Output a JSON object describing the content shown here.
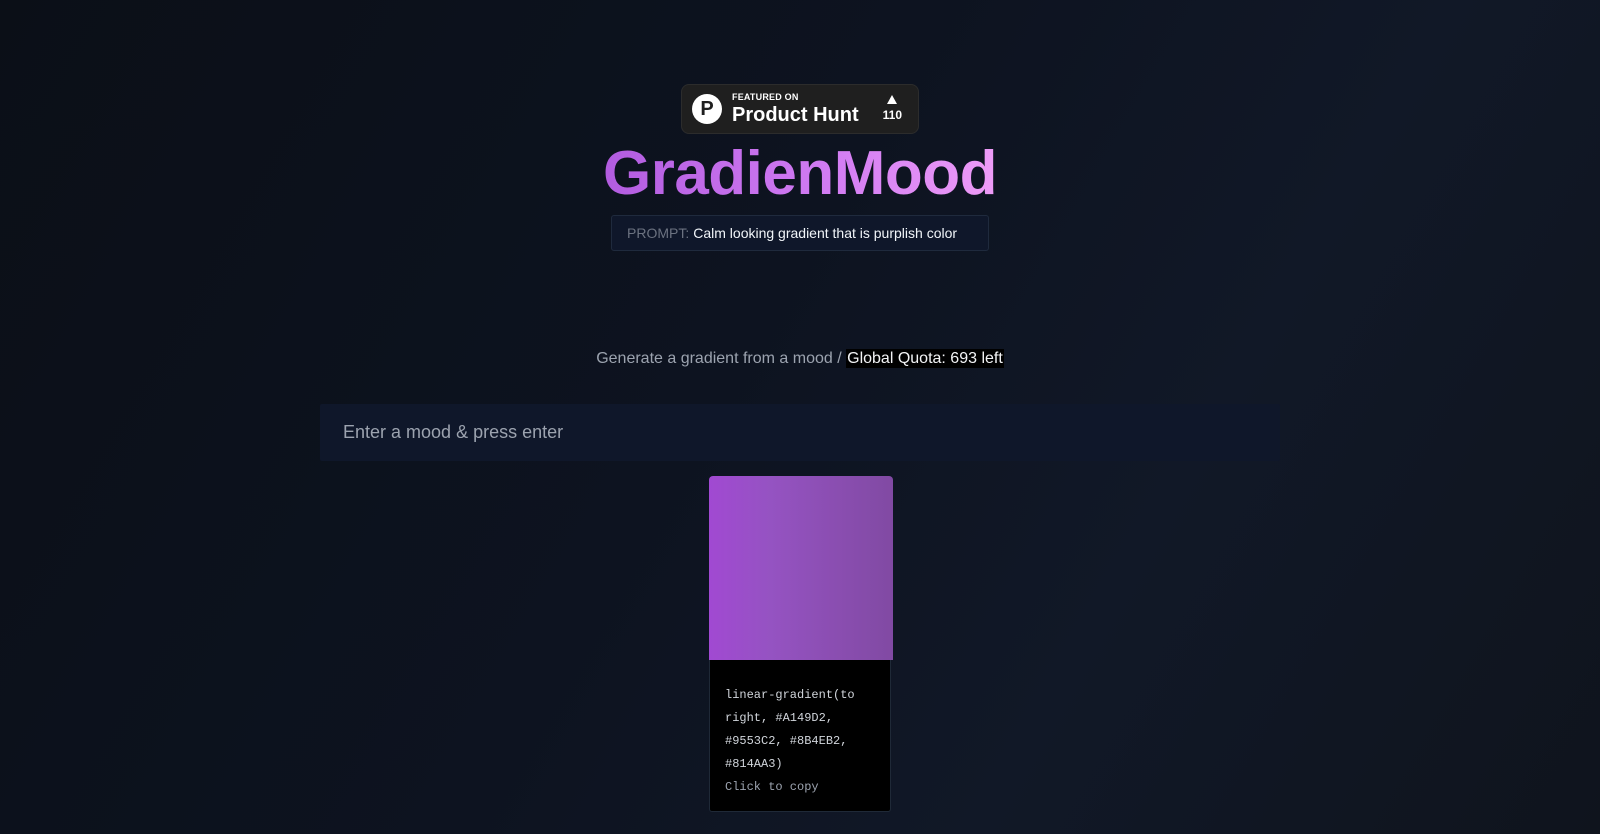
{
  "product_hunt": {
    "featured": "FEATURED ON",
    "name": "Product Hunt",
    "logo_letter": "P",
    "votes": "110"
  },
  "header": {
    "title": "GradienMood",
    "prompt_label": "PROMPT:",
    "prompt_value": "Calm looking gradient that is purplish color"
  },
  "main": {
    "subtitle": "Generate a gradient from a mood /",
    "quota": "Global Quota: 693 left",
    "input_placeholder": "Enter a mood & press enter",
    "input_value": ""
  },
  "result": {
    "css": "linear-gradient(to right, #A149D2, #9553C2, #8B4EB2, #814AA3)",
    "copy_hint": "Click to copy",
    "colors": [
      "#A149D2",
      "#9553C2",
      "#8B4EB2",
      "#814AA3"
    ]
  },
  "colors": {
    "title_gradient_start": "#b25ce0",
    "title_gradient_end": "#ee9cf7",
    "background": "#0d1320",
    "input_background": "#0f172a"
  }
}
